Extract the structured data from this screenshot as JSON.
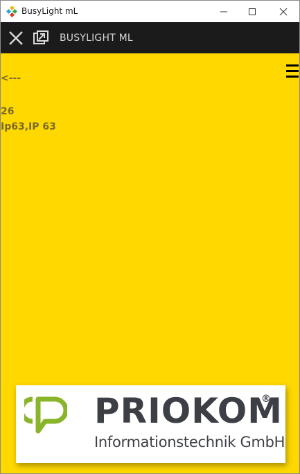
{
  "window": {
    "title": "BusyLight mL"
  },
  "appbar": {
    "title": "BUSYLIGHT ML"
  },
  "content": {
    "back_link": "<---",
    "value1": "26",
    "value2": "Ip63,IP 63"
  },
  "logo": {
    "brand": "PRIOKOM",
    "registered": "®",
    "subtitle": "Informationstechnik GmbH"
  },
  "colors": {
    "background": "#ffd800",
    "appbar": "#1b1b1b",
    "logo_green": "#8ab52a",
    "logo_text": "#3c3f45"
  },
  "icons": [
    "app-icon",
    "minimize-icon",
    "maximize-icon",
    "close-icon",
    "appbar-close-icon",
    "popout-icon",
    "hamburger-menu-icon",
    "priokom-logo-icon"
  ]
}
